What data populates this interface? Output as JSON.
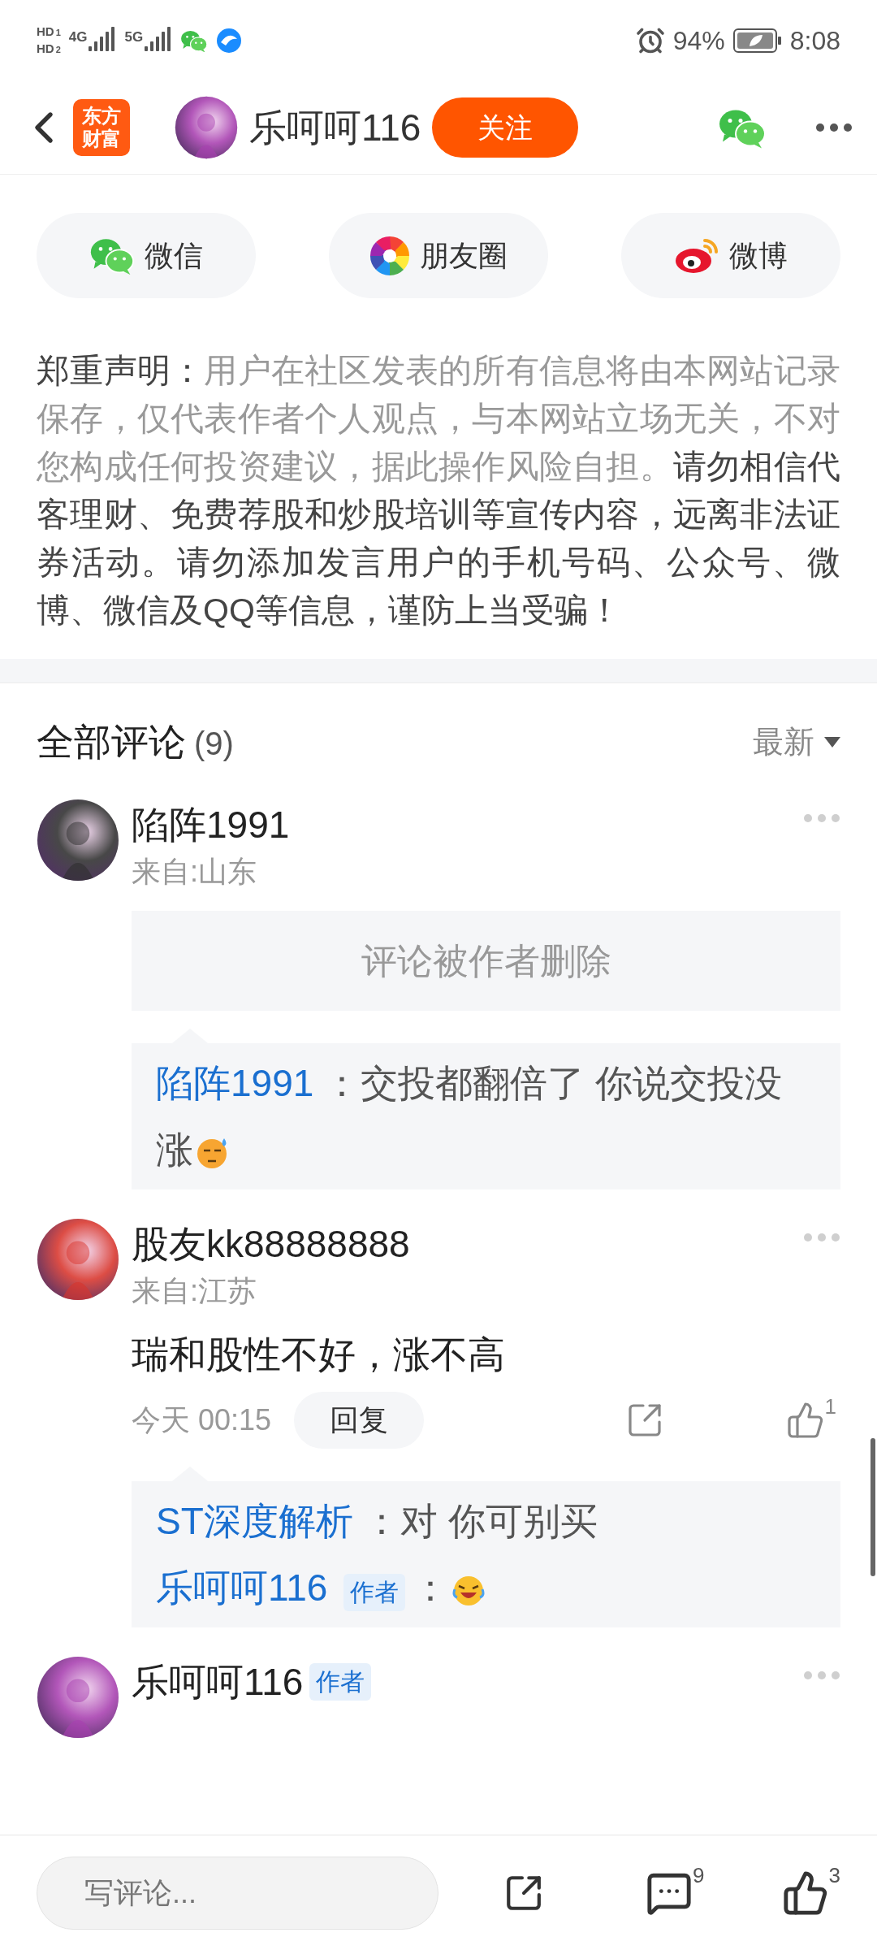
{
  "status_bar": {
    "sims": [
      {
        "label": "HD",
        "slot": "1"
      },
      {
        "label": "HD",
        "slot": "2"
      }
    ],
    "networks": [
      {
        "label": "4G"
      },
      {
        "label": "5G"
      }
    ],
    "battery": "94%",
    "time": "8:08"
  },
  "header": {
    "logo_lines": [
      "东方",
      "财富"
    ],
    "username": "乐呵呵116",
    "follow_button": "关注"
  },
  "share_buttons": [
    {
      "kind": "wechat",
      "label": "微信"
    },
    {
      "kind": "moments",
      "label": "朋友圈"
    },
    {
      "kind": "weibo",
      "label": "微博"
    }
  ],
  "disclaimer": [
    {
      "text": "郑重声明：",
      "muted": false
    },
    {
      "text": "用户在社区发表的所有信息将由本网站记录保存，仅代表作者个人观点，与本网站立场无关，不对您构成任何投资建议，据此操作风险自担。",
      "muted": true
    },
    {
      "text": "请勿相信代客理财、免费荐股和炒股培训等宣传内容，远离非法证券活动。请勿添加发言用户的手机号码、公众号、微博、微信及QQ等信息，谨防上当受骗！",
      "muted": false
    }
  ],
  "comments_header": {
    "title": "全部评论",
    "count": "(9)",
    "sort": "最新"
  },
  "comments": [
    {
      "user": "陷阵1991",
      "location": "来自:山东",
      "deleted_notice": "评论被作者删除",
      "replies": [
        {
          "user": "陷阵1991",
          "text": "：交投都翻倍了 你说交投没涨",
          "emoji": true
        }
      ]
    },
    {
      "user": "股友kk88888888",
      "location": "来自:江苏",
      "content": "瑞和股性不好，涨不高",
      "time": "今天 00:15",
      "reply_button": "回复",
      "likes": "1",
      "replies": [
        {
          "user": "ST深度解析",
          "text": "：对 你可别买",
          "emoji": false
        },
        {
          "user": "乐呵呵116",
          "badge": "作者",
          "text": "：",
          "emoji": true
        }
      ]
    },
    {
      "user": "乐呵呵116",
      "badge": "作者"
    }
  ],
  "bottom_bar": {
    "placeholder": "写评论...",
    "comment_count": "9",
    "like_count": "3"
  }
}
